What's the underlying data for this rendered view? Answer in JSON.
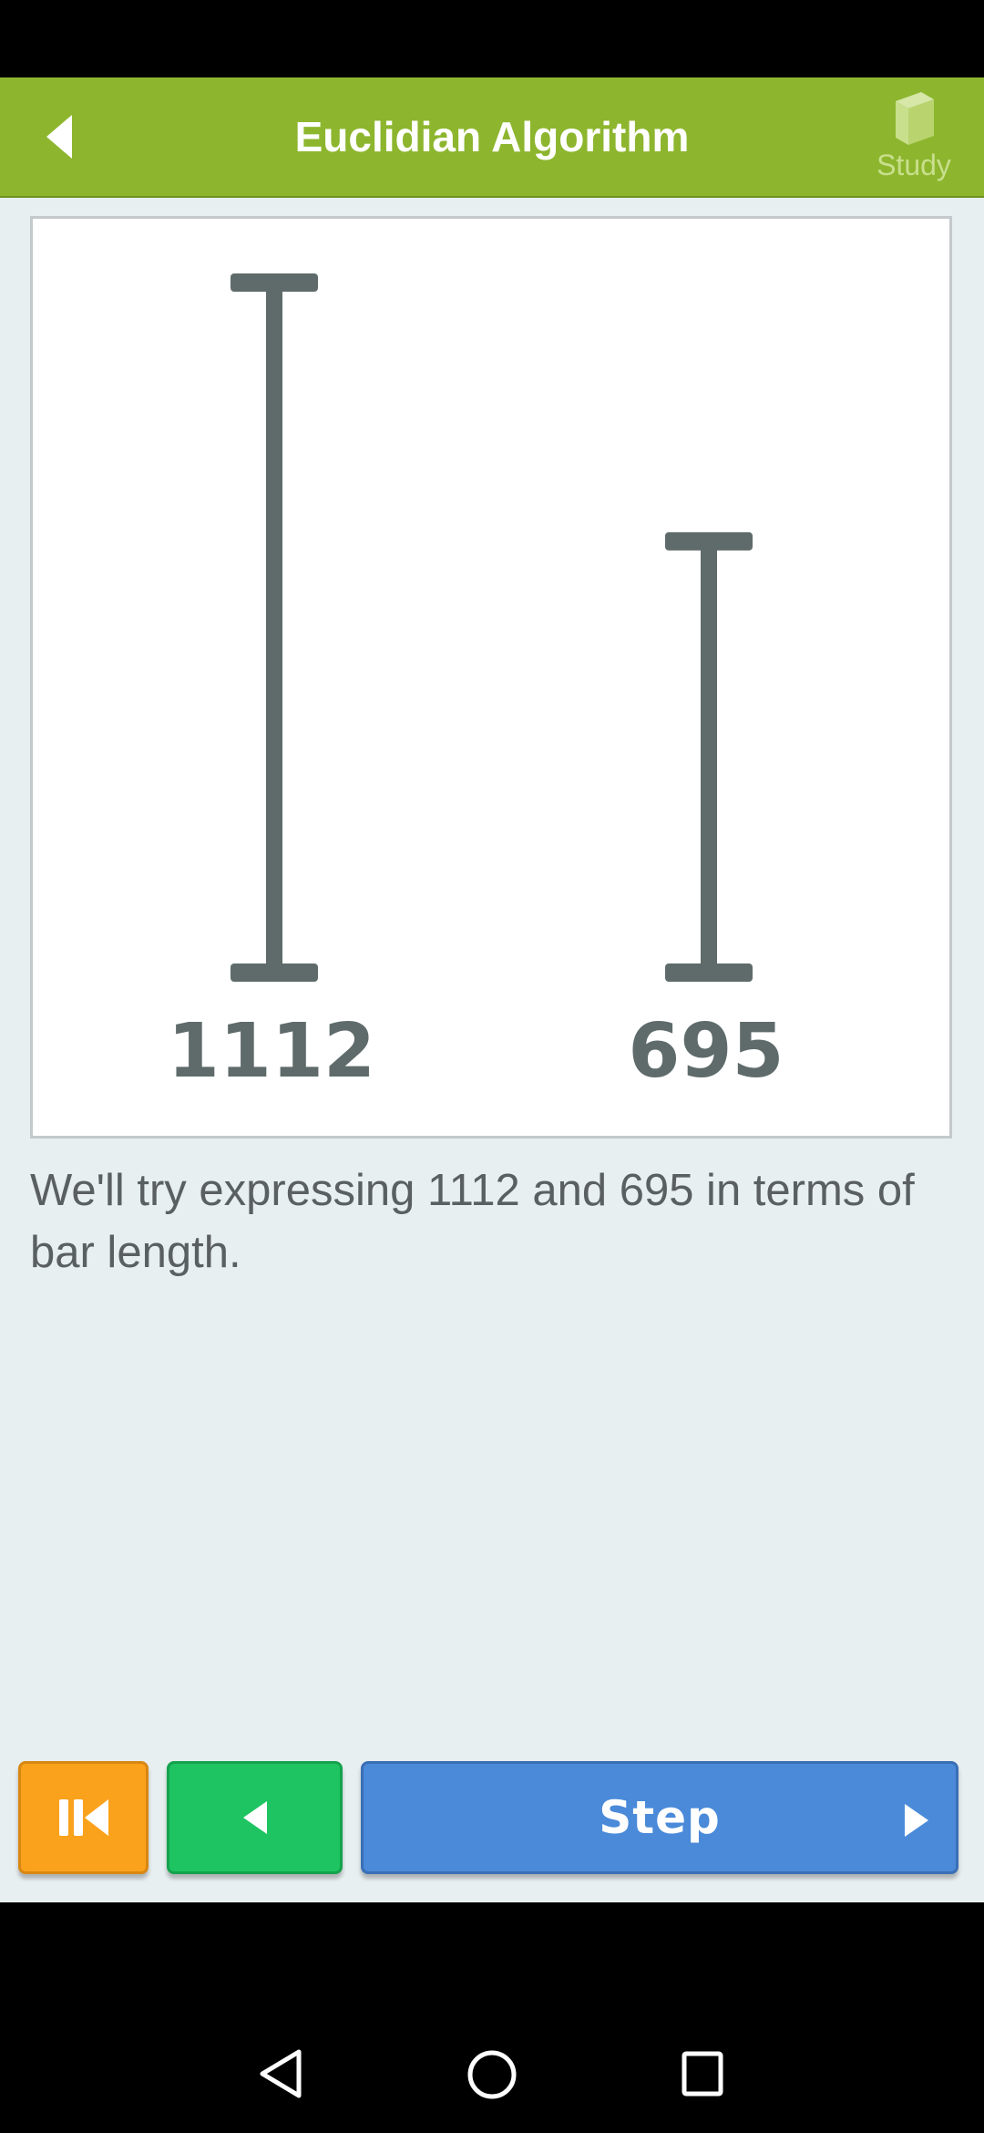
{
  "app_bar": {
    "title": "Euclidian Algorithm",
    "back_icon": "triangle-left-icon",
    "study_icon": "book-icon",
    "study_label": "Study",
    "background_color": "#8db62e"
  },
  "bars": [
    {
      "value": 1112,
      "label": "1112"
    },
    {
      "value": 695,
      "label": "695"
    }
  ],
  "explanation": "We'll try expressing 1112 and 695 in terms of bar length.",
  "controls": {
    "reset_icon": "skip-to-start-icon",
    "prev_icon": "triangle-left-icon",
    "step_label": "Step",
    "step_icon": "triangle-right-icon",
    "colors": {
      "reset": "#fba21d",
      "prev": "#1ec461",
      "step": "#4a8ad9"
    }
  },
  "system_nav": {
    "back_icon": "nav-back-icon",
    "home_icon": "nav-home-icon",
    "recents_icon": "nav-recents-icon"
  }
}
